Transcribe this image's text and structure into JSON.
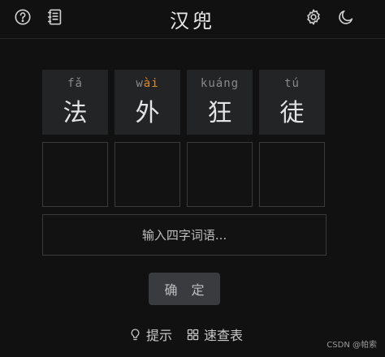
{
  "header": {
    "title": "汉兜",
    "icons": [
      "help-icon",
      "notebook-icon",
      "gear-icon",
      "moon-icon"
    ]
  },
  "hints": [
    {
      "py_pre": "f",
      "py_hl": "",
      "py_post": "ǎ",
      "char": "法"
    },
    {
      "py_pre": "w",
      "py_hl": "ài",
      "py_post": "",
      "char": "外"
    },
    {
      "py_pre": "ku",
      "py_hl": "",
      "py_post": "áng",
      "char": "狂"
    },
    {
      "py_pre": "t",
      "py_hl": "",
      "py_post": "ú",
      "char": "徒"
    }
  ],
  "colors": {
    "background": "#111111",
    "tile": "#232426",
    "highlight": "#e0892d",
    "button": "#393b3e"
  },
  "input": {
    "placeholder": "输入四字词语..."
  },
  "confirm_label": "确 定",
  "footer": {
    "hint_label": "提示",
    "table_label": "速查表"
  },
  "watermark": "CSDN @帕索"
}
